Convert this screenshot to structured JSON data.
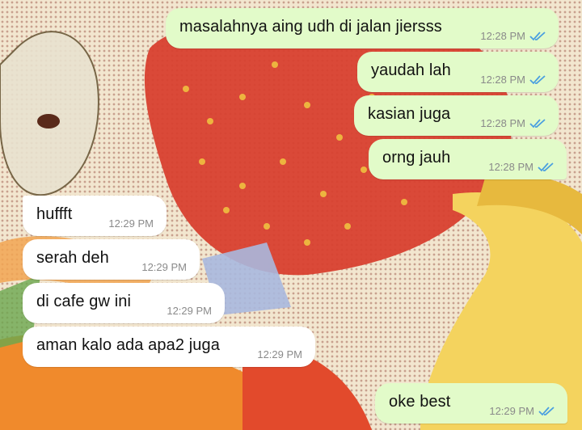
{
  "colors": {
    "outgoing_bubble": "#e2fbc9",
    "incoming_bubble": "#ffffff",
    "read_check": "#4a9fe0",
    "time_text": "#8a8a8a"
  },
  "messages": [
    {
      "direction": "out",
      "text": "masalahnya aing udh di jalan jiersss",
      "time": "12:28 PM",
      "status": "read-double-check-icon"
    },
    {
      "direction": "out",
      "text": "yaudah lah",
      "time": "12:28 PM",
      "status": "read-double-check-icon"
    },
    {
      "direction": "out",
      "text": "kasian juga",
      "time": "12:28 PM",
      "status": "read-double-check-icon"
    },
    {
      "direction": "out",
      "text": "orng jauh",
      "time": "12:28 PM",
      "status": "read-double-check-icon"
    },
    {
      "direction": "in",
      "text": "huffft",
      "time": "12:29 PM"
    },
    {
      "direction": "in",
      "text": "serah deh",
      "time": "12:29 PM"
    },
    {
      "direction": "in",
      "text": "di cafe gw ini",
      "time": "12:29 PM"
    },
    {
      "direction": "in",
      "text": "aman kalo ada apa2 juga",
      "time": "12:29 PM"
    },
    {
      "direction": "out",
      "text": "oke best",
      "time": "12:29 PM",
      "status": "read-double-check-icon"
    }
  ]
}
